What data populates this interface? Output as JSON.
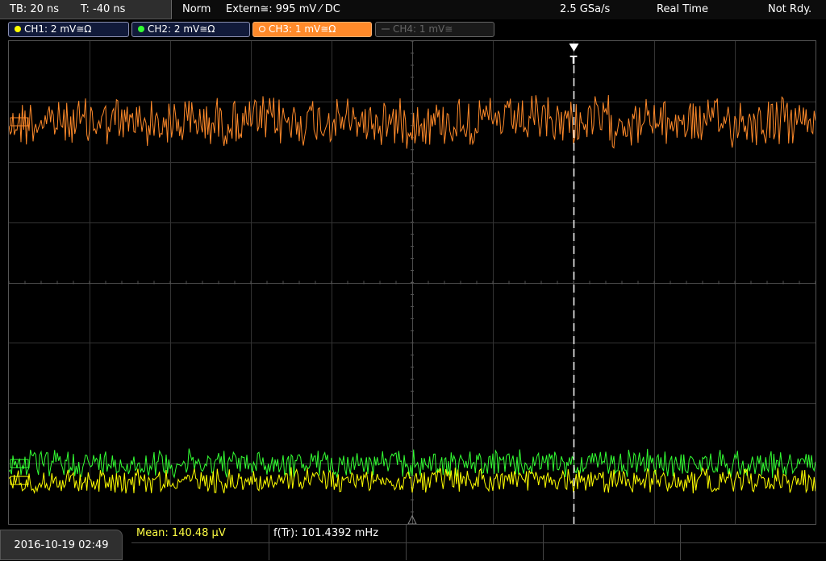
{
  "topbar": {
    "timebase": "TB: 20 ns",
    "trigger_time": "T: -40 ns",
    "trigger_mode": "Norm",
    "trigger_source": "Extern≅: 995 mV ⁄ DC",
    "sample_rate": "2.5 GSa/s",
    "acq_mode": "Real Time",
    "status": "Not Rdy."
  },
  "channels": [
    {
      "label": "CH1: 2 mV≅Ω",
      "color": "#ffff00",
      "active": true
    },
    {
      "label": "CH2: 2 mV≅Ω",
      "color": "#33ff33",
      "active": true
    },
    {
      "label": "CH3: 1 mV≅Ω",
      "color": "#ff8a2a",
      "active": true
    },
    {
      "label": "CH4: 1 mV≅",
      "color": "#666666",
      "active": false
    }
  ],
  "measurements": {
    "mean": "Mean: 140.48 µV",
    "frequency": "f(Tr): 101.4392 mHz"
  },
  "datetime": "2016-10-19 02:49",
  "trigger_marker": "T",
  "chart_data": {
    "type": "line",
    "grid": true,
    "series": [
      {
        "name": "CH3",
        "color": "#ff8a2a",
        "level": 0.167,
        "amplitude": 0.055
      },
      {
        "name": "CH2",
        "color": "#33ff33",
        "level": 0.875,
        "amplitude": 0.03
      },
      {
        "name": "CH1",
        "color": "#ffff00",
        "level": 0.91,
        "amplitude": 0.028
      }
    ],
    "trigger_position": 0.7
  }
}
